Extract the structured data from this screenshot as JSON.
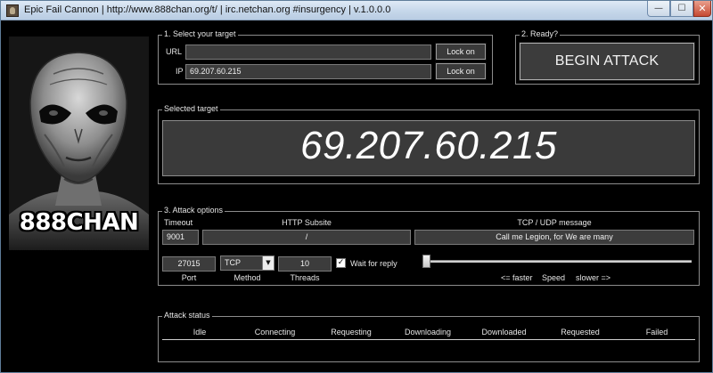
{
  "window": {
    "title": "Epic Fail Cannon | http://www.888chan.org/t/ | irc.netchan.org #insurgency | v.1.0.0.0",
    "min_glyph": "—",
    "max_glyph": "☐",
    "close_glyph": "✕"
  },
  "logo": {
    "text": "888CHAN"
  },
  "target_group": {
    "legend": "1. Select your target",
    "url_label": "URL",
    "url_value": "",
    "ip_label": "IP",
    "ip_value": "69.207.60.215",
    "lock_url_label": "Lock on",
    "lock_ip_label": "Lock on"
  },
  "ready_group": {
    "legend": "2. Ready?",
    "begin_label": "BEGIN ATTACK"
  },
  "selected_group": {
    "legend": "Selected target",
    "value": "69.207.60.215"
  },
  "options_group": {
    "legend": "3. Attack options",
    "timeout_label": "Timeout",
    "timeout_value": "9001",
    "subsite_label": "HTTP Subsite",
    "subsite_value": "/",
    "message_label": "TCP / UDP message",
    "message_value": "Call me Legion, for We are many",
    "port_value": "27015",
    "port_label": "Port",
    "method_value": "TCP",
    "method_label": "Method",
    "threads_value": "10",
    "threads_label": "Threads",
    "wait_checked": true,
    "wait_label": "Wait for reply",
    "speed_faster": "<= faster",
    "speed_label": "Speed",
    "speed_slower": "slower =>",
    "speed_level": 0
  },
  "status_group": {
    "legend": "Attack status",
    "columns": [
      "Idle",
      "Connecting",
      "Requesting",
      "Downloading",
      "Downloaded",
      "Requested",
      "Failed"
    ]
  },
  "colors": {
    "background": "#000000",
    "field": "#3c3c3c",
    "text": "#e6e6e6",
    "border": "#8c8c8c"
  }
}
